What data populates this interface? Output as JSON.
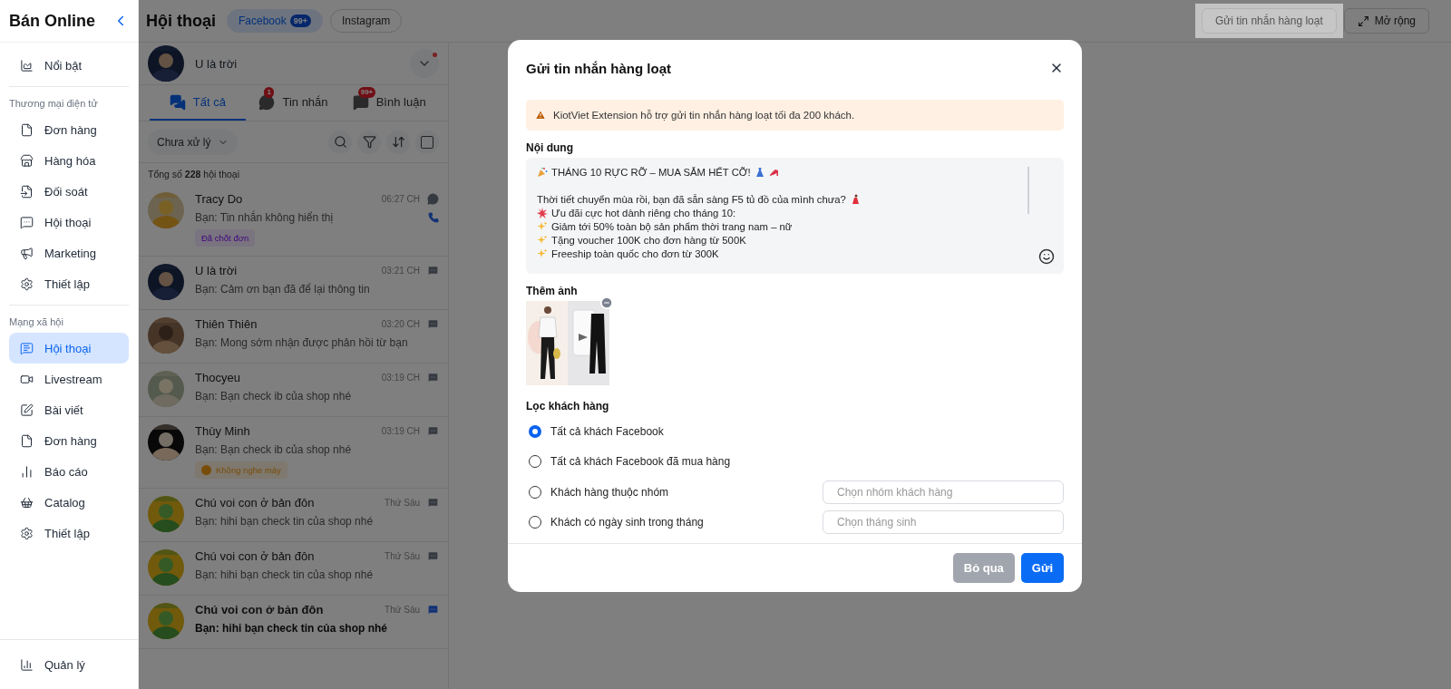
{
  "sidebar": {
    "title": "Bán Online",
    "sections": [
      {
        "items": [
          {
            "label": "Nổi bật",
            "selected": false
          }
        ]
      },
      {
        "heading": "Thương mại điện tử",
        "items": [
          {
            "label": "Đơn hàng",
            "selected": false
          },
          {
            "label": "Hàng hóa",
            "selected": false
          },
          {
            "label": "Đối soát",
            "selected": false
          },
          {
            "label": "Hội thoại",
            "selected": false
          },
          {
            "label": "Marketing",
            "selected": false
          },
          {
            "label": "Thiết lập",
            "selected": false
          }
        ]
      },
      {
        "heading": "Mạng xã hội",
        "items": [
          {
            "label": "Hội thoại",
            "selected": true
          },
          {
            "label": "Livestream",
            "selected": false
          },
          {
            "label": "Bài viết",
            "selected": false
          },
          {
            "label": "Đơn hàng",
            "selected": false
          },
          {
            "label": "Báo cáo",
            "selected": false
          },
          {
            "label": "Catalog",
            "selected": false
          },
          {
            "label": "Thiết lập",
            "selected": false
          }
        ]
      }
    ],
    "footer_item": {
      "label": "Quản lý"
    }
  },
  "header": {
    "title": "Hội thoại",
    "channels": [
      {
        "label": "Facebook",
        "badge": "99+",
        "selected": true
      },
      {
        "label": "Instagram",
        "selected": false
      }
    ],
    "actions": [
      {
        "label": "Gửi tin nhắn hàng loạt",
        "highlighted": true
      },
      {
        "label": "Mở rộng",
        "highlighted": false
      }
    ]
  },
  "conversations": {
    "account": "U là trời",
    "tabs": [
      {
        "label": "Tất cả",
        "selected": true
      },
      {
        "label": "Tin nhắn",
        "badge": "1",
        "selected": false
      },
      {
        "label": "Bình luận",
        "badge": "99+",
        "selected": false
      }
    ],
    "filter": "Chưa xử lý",
    "select_all": {
      "checked": false
    },
    "total": "Tổng số **228** hội thoại",
    "items": [
      {
        "name": "Tracy Do",
        "time": "06:27 CH",
        "preview": "Bạn: Tin nhắn không hiển thị",
        "kind": "messenger",
        "phone": true,
        "tag": {
          "label": "Đã chốt đơn",
          "kind": "note"
        },
        "unread": false
      },
      {
        "name": "U là trời",
        "time": "03:21 CH",
        "preview": "Bạn: Cảm ơn bạn đã để lại thông tin",
        "kind": "comment",
        "phone": false,
        "unread": false
      },
      {
        "name": "Thiên Thiên",
        "time": "03:20 CH",
        "preview": "Bạn: Mong sớm nhận được phản hồi từ bạn",
        "kind": "comment",
        "phone": false,
        "unread": false
      },
      {
        "name": "Thocyeu",
        "time": "03:19 CH",
        "preview": "Bạn: Bạn check ib của shop nhé",
        "kind": "comment",
        "phone": false,
        "unread": false
      },
      {
        "name": "Thùy Minh",
        "time": "03:19 CH",
        "preview": "Bạn: Bạn check ib của shop nhé",
        "kind": "comment",
        "phone": false,
        "tag": {
          "label": "Không nghe máy",
          "kind": "alert"
        },
        "unread": false
      },
      {
        "name": "Chú voi con ở bản đôn",
        "time": "Thứ Sáu",
        "preview": "Bạn: hihi bạn check tin của shop nhé",
        "kind": "comment",
        "phone": false,
        "unread": false
      },
      {
        "name": "Chú voi con ở bản đôn",
        "time": "Thứ Sáu",
        "preview": "Bạn: hihi bạn check tin của shop nhé",
        "kind": "comment",
        "phone": false,
        "unread": false
      },
      {
        "name": "Chú voi con ở bản đôn",
        "time": "Thứ Sáu",
        "preview": "Bạn: hihi bạn check tin của shop nhé",
        "kind": "comment",
        "phone": false,
        "unread": true
      }
    ]
  },
  "modal": {
    "title": "Gửi tin nhắn hàng loạt",
    "warning": "KiotViet Extension hỗ trợ gửi tin nhắn hàng loạt tối đa 200 khách.",
    "content_label": "Nội dung",
    "message": [
      {
        "kind": "headline",
        "text": "THÁNG 10 RỰC RỠ – MUA SẮM HẾT CỠ!"
      },
      {
        "kind": "blank"
      },
      {
        "kind": "question",
        "text": "Thời tiết chuyển mùa rồi, bạn đã sẵn sàng F5 tủ đồ của mình chưa?"
      },
      {
        "kind": "burst",
        "text": "Ưu đãi cực hot dành riêng cho tháng 10:"
      },
      {
        "kind": "sparkle",
        "text": "Giảm tới 50% toàn bộ sản phẩm thời trang nam – nữ"
      },
      {
        "kind": "sparkle",
        "text": "Tặng voucher 100K cho đơn hàng từ 500K"
      },
      {
        "kind": "sparkle",
        "text": "Freeship toàn quốc cho đơn từ 300K"
      }
    ],
    "images_label": "Thêm ảnh",
    "filter_label": "Lọc khách hàng",
    "options": [
      {
        "label": "Tất cả khách Facebook",
        "selected": true
      },
      {
        "label": "Tất cả khách Facebook đã mua hàng",
        "selected": false
      },
      {
        "label": "Khách hàng thuộc nhóm",
        "selected": false,
        "placeholder": "Chọn nhóm khách hàng"
      },
      {
        "label": "Khách có ngày sinh trong tháng",
        "selected": false,
        "placeholder": "Chọn tháng sinh"
      }
    ],
    "buttons": [
      {
        "label": "Bỏ qua",
        "kind": "secondary"
      },
      {
        "label": "Gửi",
        "kind": "primary"
      }
    ]
  }
}
